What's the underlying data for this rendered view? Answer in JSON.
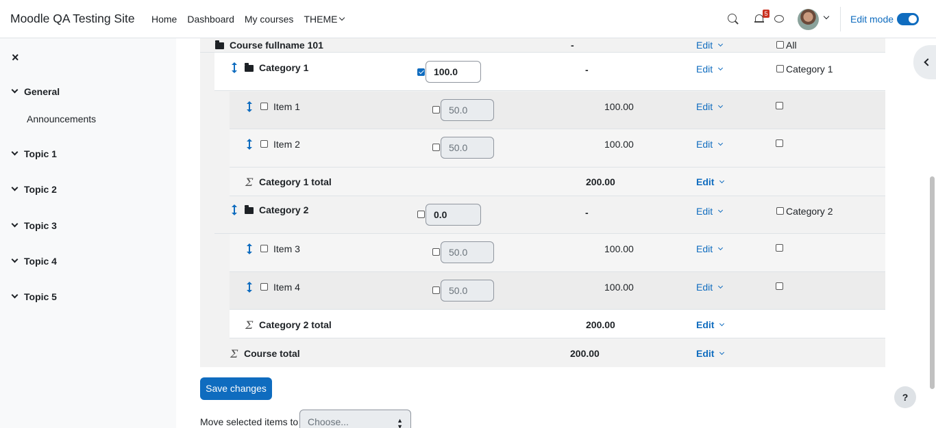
{
  "navbar": {
    "site_name": "Moodle QA Testing Site",
    "links": [
      "Home",
      "Dashboard",
      "My courses"
    ],
    "theme_label": "THEME",
    "notification_count": "5",
    "edit_mode_label": "Edit mode",
    "edit_mode_on": true
  },
  "drawer": {
    "close_symbol": "×",
    "sections": [
      {
        "label": "General",
        "items": [
          "Announcements"
        ]
      },
      {
        "label": "Topic 1"
      },
      {
        "label": "Topic 2"
      },
      {
        "label": "Topic 3"
      },
      {
        "label": "Topic 4"
      },
      {
        "label": "Topic 5"
      }
    ]
  },
  "gradebook": {
    "course_row": {
      "name": "Course fullname 101",
      "max": "-",
      "edit": "Edit",
      "select_label": "All"
    },
    "rows": [
      {
        "type": "category",
        "name": "Category 1",
        "weight_checked": true,
        "weight": "100.0",
        "max": "-",
        "edit": "Edit",
        "select_label": "Category 1"
      },
      {
        "type": "item",
        "name": "Item 1",
        "weight_checked": false,
        "weight": "50.0",
        "max": "100.00",
        "edit": "Edit"
      },
      {
        "type": "item",
        "name": "Item 2",
        "weight_checked": false,
        "weight": "50.0",
        "max": "100.00",
        "edit": "Edit"
      },
      {
        "type": "total",
        "name": "Category 1 total",
        "max": "200.00",
        "edit": "Edit"
      },
      {
        "type": "category",
        "name": "Category 2",
        "weight_checked": false,
        "weight": "0.0",
        "max": "-",
        "edit": "Edit",
        "select_label": "Category 2"
      },
      {
        "type": "item",
        "name": "Item 3",
        "weight_checked": false,
        "weight": "50.0",
        "max": "100.00",
        "edit": "Edit"
      },
      {
        "type": "item",
        "name": "Item 4",
        "weight_checked": false,
        "weight": "50.0",
        "max": "100.00",
        "edit": "Edit"
      },
      {
        "type": "total",
        "name": "Category 2 total",
        "max": "200.00",
        "edit": "Edit"
      },
      {
        "type": "course_total",
        "name": "Course total",
        "max": "200.00",
        "edit": "Edit"
      }
    ]
  },
  "actions": {
    "save_label": "Save changes",
    "move_label": "Move selected items to",
    "move_placeholder": "Choose..."
  },
  "help_symbol": "?"
}
